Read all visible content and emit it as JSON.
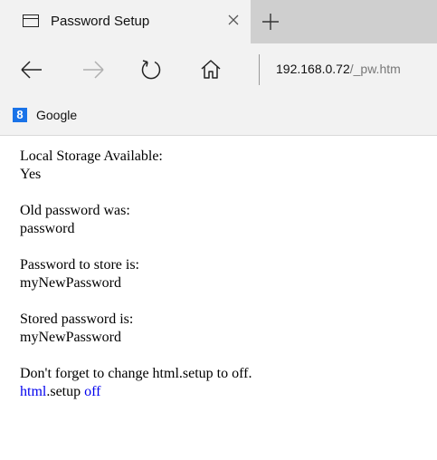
{
  "tab": {
    "title": "Password Setup"
  },
  "address": {
    "host": "192.168.0.72",
    "path": "/_pw.htm"
  },
  "favorites": [
    {
      "label": "Google",
      "icon": "google-icon"
    }
  ],
  "content": {
    "local_storage_label": "Local Storage Available:",
    "local_storage_value": "Yes",
    "old_password_label": "Old password was:",
    "old_password_value": "password",
    "to_store_label": "Password to store is:",
    "to_store_value": "myNewPassword",
    "stored_label": "Stored password is:",
    "stored_value": "myNewPassword",
    "reminder": "Don't forget to change html.setup to off.",
    "link_html": "html",
    "setup_text": ".setup ",
    "link_off": "off"
  },
  "colors": {
    "link": "#0000ee",
    "chrome": "#f2f2f2",
    "tabstrip": "#cfcfcf"
  }
}
